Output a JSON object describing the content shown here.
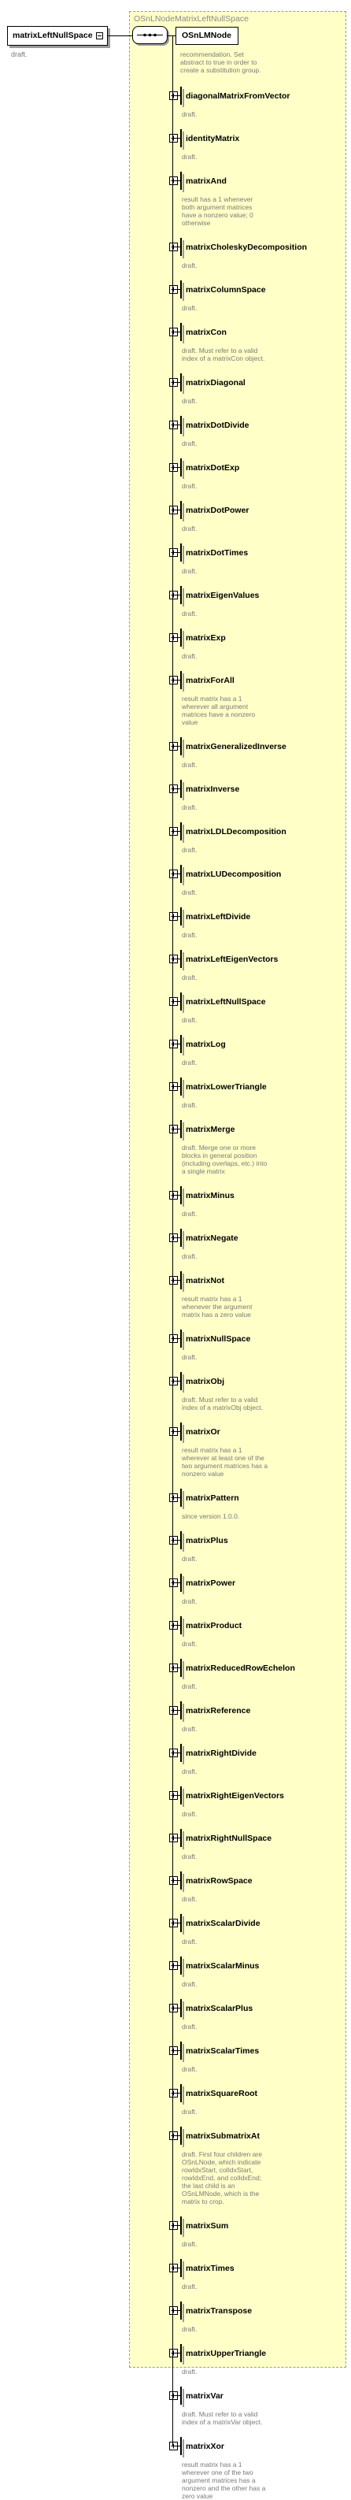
{
  "root": {
    "label": "matrixLeftNullSpace",
    "description": "draft."
  },
  "group": {
    "title": "OSnLNodeMatrixLeftNullSpace",
    "base_label": "OSnLMNode",
    "base_description": [
      "recommendation. Set",
      "abstract to true in order to",
      "create a substitution group."
    ]
  },
  "items": [
    {
      "label": "diagonalMatrixFromVector",
      "desc": [
        "draft."
      ]
    },
    {
      "label": "identityMatrix",
      "desc": [
        "draft."
      ]
    },
    {
      "label": "matrixAnd",
      "desc": [
        "result has a 1 whenever",
        "both argument matrices",
        "have a nonzero value; 0",
        "otherwise"
      ]
    },
    {
      "label": "matrixCholeskyDecomposition",
      "desc": [
        "draft."
      ]
    },
    {
      "label": "matrixColumnSpace",
      "desc": [
        "draft."
      ]
    },
    {
      "label": "matrixCon",
      "desc": [
        "draft. Must refer to a valid",
        "index of a matrixCon object."
      ]
    },
    {
      "label": "matrixDiagonal",
      "desc": [
        "draft."
      ]
    },
    {
      "label": "matrixDotDivide",
      "desc": [
        "draft."
      ]
    },
    {
      "label": "matrixDotExp",
      "desc": [
        "draft."
      ]
    },
    {
      "label": "matrixDotPower",
      "desc": [
        "draft."
      ]
    },
    {
      "label": "matrixDotTimes",
      "desc": [
        "draft."
      ]
    },
    {
      "label": "matrixEigenValues",
      "desc": [
        "draft."
      ]
    },
    {
      "label": "matrixExp",
      "desc": [
        "draft."
      ]
    },
    {
      "label": "matrixForAll",
      "desc": [
        "result matrix has a 1",
        "wherever all argument",
        "matrices have a nonzero",
        "value"
      ]
    },
    {
      "label": "matrixGeneralizedInverse",
      "desc": [
        "draft."
      ]
    },
    {
      "label": "matrixInverse",
      "desc": [
        "draft."
      ]
    },
    {
      "label": "matrixLDLDecomposition",
      "desc": [
        "draft."
      ]
    },
    {
      "label": "matrixLUDecomposition",
      "desc": [
        "draft."
      ]
    },
    {
      "label": "matrixLeftDivide",
      "desc": [
        "draft."
      ]
    },
    {
      "label": "matrixLeftEigenVectors",
      "desc": [
        "draft."
      ]
    },
    {
      "label": "matrixLeftNullSpace",
      "desc": [
        "draft."
      ]
    },
    {
      "label": "matrixLog",
      "desc": [
        "draft."
      ]
    },
    {
      "label": "matrixLowerTriangle",
      "desc": [
        "draft."
      ]
    },
    {
      "label": "matrixMerge",
      "desc": [
        "draft. Merge one or more",
        "blocks in general position",
        "(including overlaps, etc.) into",
        "a single matrix"
      ]
    },
    {
      "label": "matrixMinus",
      "desc": [
        "draft."
      ]
    },
    {
      "label": "matrixNegate",
      "desc": [
        "draft."
      ]
    },
    {
      "label": "matrixNot",
      "desc": [
        "result matrix has a 1",
        "whenever the argument",
        "matrix has a zero value"
      ]
    },
    {
      "label": "matrixNullSpace",
      "desc": [
        "draft."
      ]
    },
    {
      "label": "matrixObj",
      "desc": [
        "draft. Must refer to a valid",
        "index of a matrixObj object."
      ]
    },
    {
      "label": "matrixOr",
      "desc": [
        "result matrix has a 1",
        "wherever at least one of the",
        "two argument matrices has a",
        "nonzero value"
      ]
    },
    {
      "label": "matrixPattern",
      "desc": [
        "since version 1.0.0."
      ]
    },
    {
      "label": "matrixPlus",
      "desc": [
        "draft."
      ]
    },
    {
      "label": "matrixPower",
      "desc": [
        "draft."
      ]
    },
    {
      "label": "matrixProduct",
      "desc": [
        "draft."
      ]
    },
    {
      "label": "matrixReducedRowEchelon",
      "desc": [
        "draft."
      ]
    },
    {
      "label": "matrixReference",
      "desc": [
        "draft."
      ]
    },
    {
      "label": "matrixRightDivide",
      "desc": [
        "draft."
      ]
    },
    {
      "label": "matrixRightEigenVectors",
      "desc": [
        "draft."
      ]
    },
    {
      "label": "matrixRightNullSpace",
      "desc": [
        "draft."
      ]
    },
    {
      "label": "matrixRowSpace",
      "desc": [
        "draft."
      ]
    },
    {
      "label": "matrixScalarDivide",
      "desc": [
        "draft."
      ]
    },
    {
      "label": "matrixScalarMinus",
      "desc": [
        "draft."
      ]
    },
    {
      "label": "matrixScalarPlus",
      "desc": [
        "draft."
      ]
    },
    {
      "label": "matrixScalarTimes",
      "desc": [
        "draft."
      ]
    },
    {
      "label": "matrixSquareRoot",
      "desc": [
        "draft."
      ]
    },
    {
      "label": "matrixSubmatrixAt",
      "desc": [
        "draft. First four children are",
        "OSnLNode, which indicate",
        "rowIdxStart, colIdxStart,",
        "rowIdxEnd, and colIdxEnd;",
        "the last child is an",
        "OSnLMNode, which is the",
        "matrix to crop."
      ]
    },
    {
      "label": "matrixSum",
      "desc": [
        "draft."
      ]
    },
    {
      "label": "matrixTimes",
      "desc": [
        "draft."
      ]
    },
    {
      "label": "matrixTranspose",
      "desc": [
        "draft."
      ]
    },
    {
      "label": "matrixUpperTriangle",
      "desc": [
        "draft."
      ]
    },
    {
      "label": "matrixVar",
      "desc": [
        "draft. Must refer to a valid",
        "index of a matrixVar object."
      ]
    },
    {
      "label": "matrixXor",
      "desc": [
        "result matrix has a 1",
        "wherever one of the two",
        "argument matrices has a",
        "nonzero and the other has a",
        "zero value"
      ]
    }
  ]
}
